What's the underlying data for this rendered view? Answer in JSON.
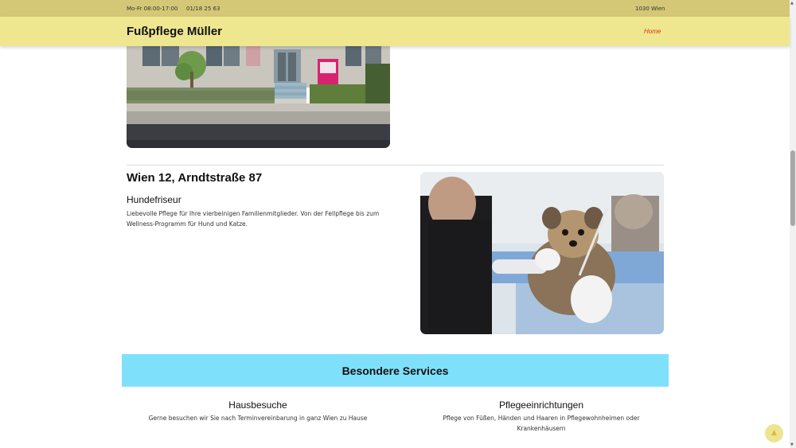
{
  "topbar": {
    "hours": "Mo-Fr 08:00-17:00",
    "phone": "01/18 25 63",
    "city": "1030 Wien"
  },
  "header": {
    "brand": "Fußpflege Müller",
    "nav_home": "Home"
  },
  "location": {
    "title": "Wien 12, Arndtstraße 87",
    "subtitle": "Hundefriseur",
    "description": "Liebevolle Pflege für Ihre vierbeinigen Familienmitglieder. Von der Fellpflege bis zum Wellness-Programm für Hund und Katze."
  },
  "services": {
    "title": "Besondere Services",
    "items": [
      {
        "name": "Hausbesuche",
        "description": "Gerne besuchen wir Sie nach Terminvereinbarung in ganz Wien zu Hause"
      },
      {
        "name": "Pflegeeinrichtungen",
        "description": "Pflege von Füßen, Händen und Haaren in Pflegewohnheimen oder Krankenhäusern"
      }
    ]
  },
  "icons": {
    "back_to_top": "arrow-up-icon"
  },
  "colors": {
    "topbar": "#d4c877",
    "header": "#efe78f",
    "nav_active": "#e0311f",
    "services_banner": "#7fe0fb"
  }
}
